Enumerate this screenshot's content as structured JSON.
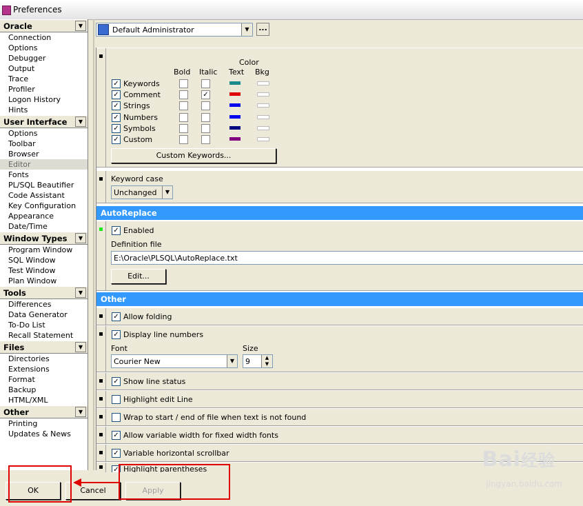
{
  "window": {
    "title": "Preferences",
    "icon": "app-icon"
  },
  "sidebar": {
    "groups": [
      {
        "title": "Oracle",
        "items": [
          "Connection",
          "Options",
          "Debugger",
          "Output",
          "Trace",
          "Profiler",
          "Logon History",
          "Hints"
        ]
      },
      {
        "title": "User Interface",
        "items": [
          "Options",
          "Toolbar",
          "Browser",
          "Editor",
          "Fonts",
          "PL/SQL Beautifier",
          "Code Assistant",
          "Key Configuration",
          "Appearance",
          "Date/Time"
        ]
      },
      {
        "title": "Window Types",
        "items": [
          "Program Window",
          "SQL Window",
          "Test Window",
          "Plan Window"
        ]
      },
      {
        "title": "Tools",
        "items": [
          "Differences",
          "Data Generator",
          "To-Do List",
          "Recall Statement"
        ]
      },
      {
        "title": "Files",
        "items": [
          "Directories",
          "Extensions",
          "Format",
          "Backup",
          "HTML/XML"
        ]
      },
      {
        "title": "Other",
        "items": [
          "Printing",
          "Updates & News"
        ]
      }
    ],
    "selected": "Editor"
  },
  "profile": {
    "value": "Default Administrator",
    "more_label": "..."
  },
  "syntax": {
    "col_bold": "Bold",
    "col_italic": "Italic",
    "col_color": "Color",
    "col_text": "Text",
    "col_bkg": "Bkg",
    "rows": [
      {
        "label": "Keywords",
        "enabled": "✓",
        "bold": "",
        "italic": "",
        "color": "#1a8a8a"
      },
      {
        "label": "Comment",
        "enabled": "✓",
        "bold": "",
        "italic": "✓",
        "color": "#e00000"
      },
      {
        "label": "Strings",
        "enabled": "✓",
        "bold": "",
        "italic": "",
        "color": "#0000ee"
      },
      {
        "label": "Numbers",
        "enabled": "✓",
        "bold": "",
        "italic": "",
        "color": "#0000ee"
      },
      {
        "label": "Symbols",
        "enabled": "✓",
        "bold": "",
        "italic": "",
        "color": "#000080"
      },
      {
        "label": "Custom",
        "enabled": "✓",
        "bold": "",
        "italic": "",
        "color": "#800080"
      }
    ],
    "custom_keywords_label": "Custom Keywords..."
  },
  "keyword_case": {
    "label": "Keyword case",
    "value": "Unchanged"
  },
  "autoreplace": {
    "header": "AutoReplace",
    "enabled_label": "Enabled",
    "enabled": "✓",
    "definition_label": "Definition file",
    "definition_value": "E:\\Oracle\\PLSQL\\AutoReplace.txt",
    "edit_label": "Edit..."
  },
  "other": {
    "header": "Other",
    "allow_folding": {
      "label": "Allow folding",
      "checked": "✓"
    },
    "line_numbers": {
      "label": "Display line numbers",
      "checked": "✓"
    },
    "font_label": "Font",
    "font_value": "Courier New",
    "size_label": "Size",
    "size_value": "9",
    "show_line_status": {
      "label": "Show line status",
      "checked": "✓"
    },
    "highlight_edit_line": {
      "label": "Highlight edit Line",
      "checked": ""
    },
    "wrap": {
      "label": "Wrap to start / end of file when text is not found",
      "checked": ""
    },
    "variable_width": {
      "label": "Allow variable width for fixed width fonts",
      "checked": "✓"
    },
    "variable_scrollbar": {
      "label": "Variable horizontal scrollbar",
      "checked": "✓"
    },
    "highlight_parentheses": {
      "label": "Highlight parentheses",
      "checked": "✓"
    }
  },
  "footer": {
    "ok_label": "OK",
    "cancel_label": "Cancel",
    "apply_label": "Apply"
  },
  "watermark": {
    "brand": "Bai",
    "brand2": "经验",
    "url": "jingyan.baidu.com"
  },
  "colors": {
    "accent_header": "#3399ff",
    "annotation_red": "#e00000",
    "dialog_bg": "#ece9d8"
  }
}
